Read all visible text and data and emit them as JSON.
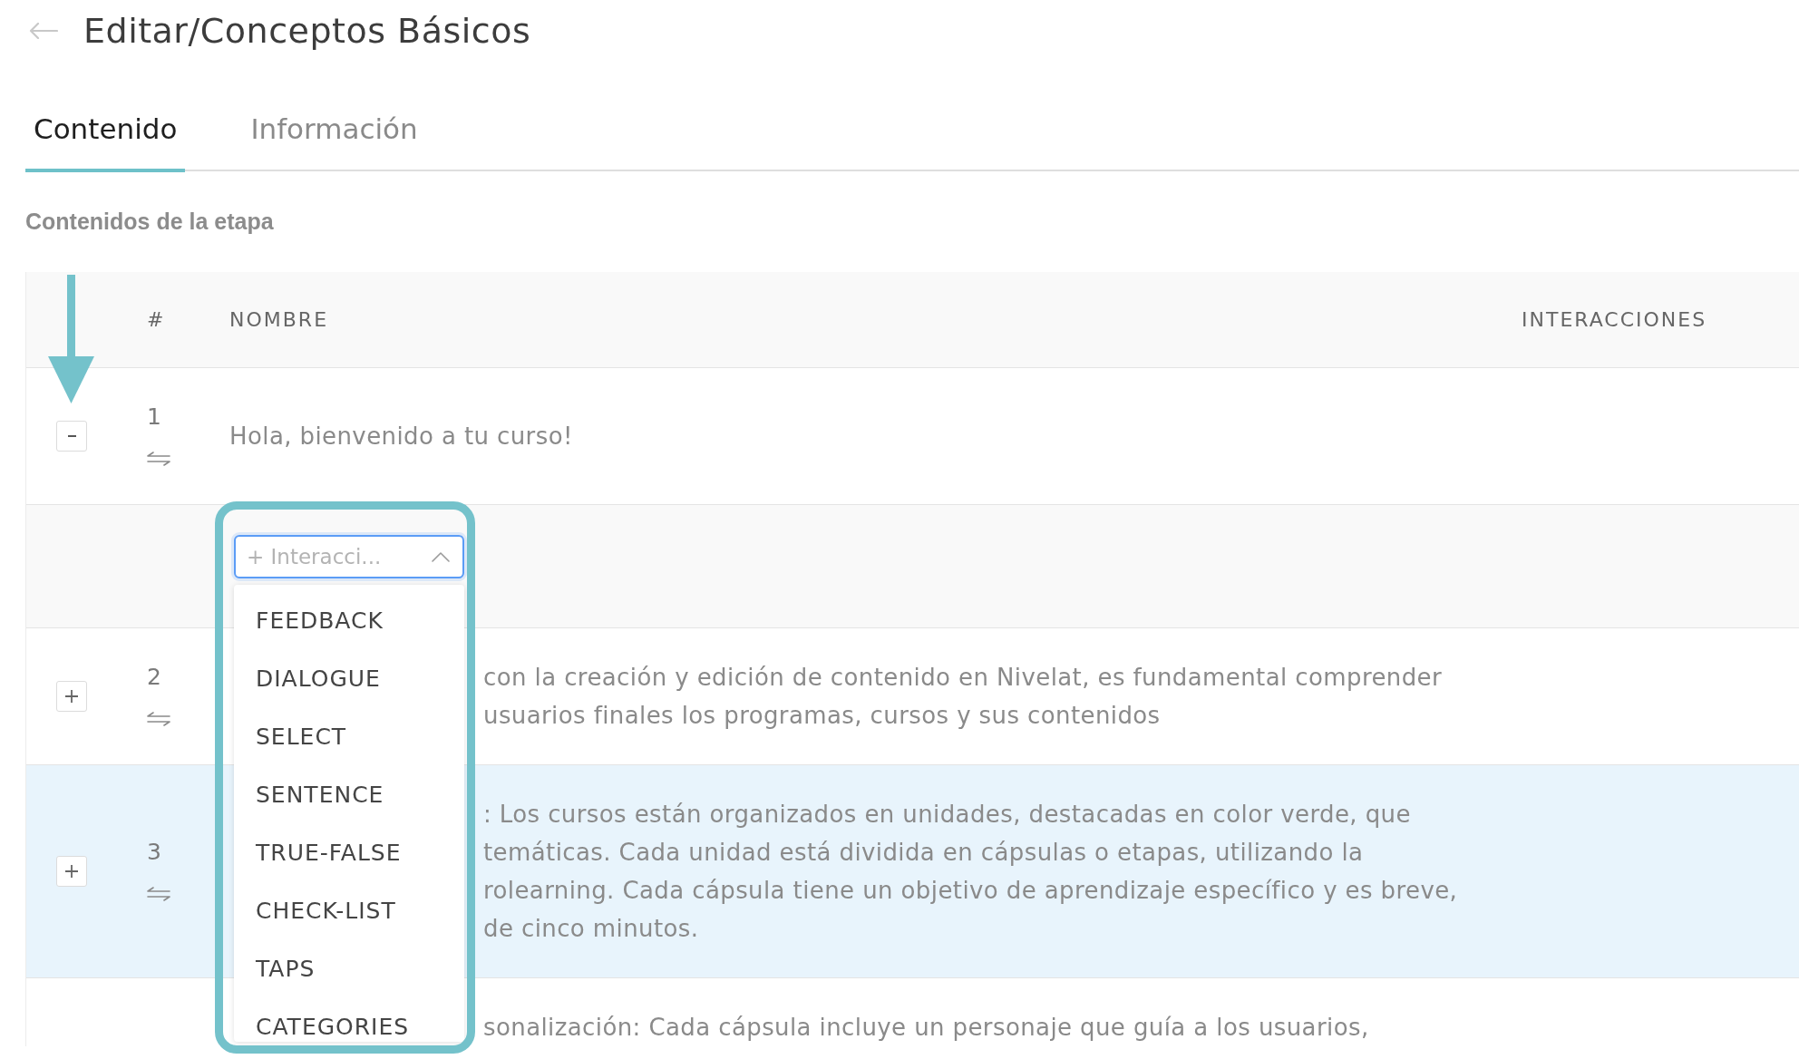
{
  "page": {
    "title": "Editar/Conceptos Básicos"
  },
  "tabs": [
    {
      "label": "Contenido",
      "selected": true
    },
    {
      "label": "Información",
      "selected": false
    }
  ],
  "section": {
    "title": "Contenidos de la etapa"
  },
  "table": {
    "columns": [
      "#",
      "NOMBRE",
      "INTERACCIONES"
    ],
    "rows": [
      {
        "number": "1",
        "name_lines": [
          "Hola, bienvenido a tu curso!"
        ],
        "expanded": true,
        "selected": false,
        "arrow_marker": true,
        "interaction_select": {
          "placeholder": "+ Interacci...",
          "open": true,
          "highlight_frame": true,
          "options": [
            "FEEDBACK",
            "DIALOGUE",
            "SELECT",
            "SENTENCE",
            "TRUE-FALSE",
            "CHECK-LIST",
            "TAPS",
            "CATEGORIES"
          ]
        }
      },
      {
        "number": "2",
        "name_lines": [
          "con la creación y edición de contenido en Nivelat, es fundamental comprender",
          "usuarios finales los programas, cursos y sus contenidos"
        ],
        "expanded": false,
        "selected": false,
        "arrow_marker": false
      },
      {
        "number": "3",
        "name_lines": [
          ": Los cursos están organizados en unidades, destacadas en color verde, que",
          "temáticas. Cada unidad está dividida en cápsulas o etapas, utilizando la",
          "rolearning. Cada cápsula tiene un objetivo de aprendizaje específico y es breve,",
          "de cinco minutos."
        ],
        "expanded": false,
        "selected": true,
        "arrow_marker": false
      },
      {
        "name_lines": [
          "sonalización: Cada cápsula incluye un personaje que guía a los usuarios,"
        ],
        "selected": false,
        "arrow_marker": false
      }
    ]
  }
}
